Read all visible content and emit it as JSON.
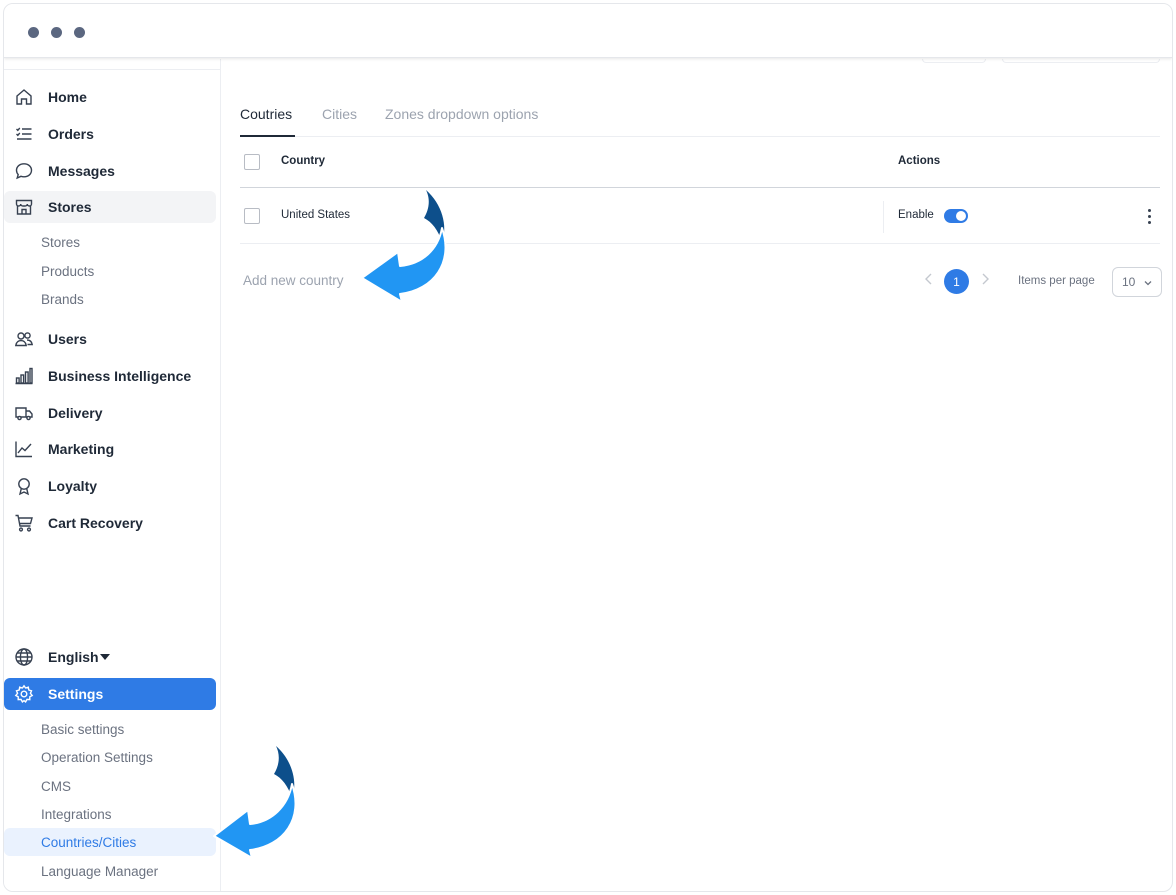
{
  "sidebar": {
    "home": "Home",
    "orders": "Orders",
    "messages": "Messages",
    "stores": "Stores",
    "stores_sub": [
      "Stores",
      "Products",
      "Brands"
    ],
    "users": "Users",
    "bi": "Business Intelligence",
    "delivery": "Delivery",
    "marketing": "Marketing",
    "loyalty": "Loyalty",
    "cart_recovery": "Cart Recovery",
    "language": "English",
    "settings": "Settings",
    "settings_sub": [
      "Basic settings",
      "Operation Settings",
      "CMS",
      "Integrations",
      "Countries/Cities",
      "Language Manager"
    ]
  },
  "tabs": [
    "Coutries",
    "Cities",
    "Zones dropdown options"
  ],
  "table": {
    "headers": {
      "country": "Country",
      "actions": "Actions"
    },
    "rows": [
      {
        "country": "United States",
        "status": "Enable"
      }
    ]
  },
  "add_link": "Add new country",
  "pagination": {
    "current_page": "1",
    "items_per_page_label": "Items per page",
    "items_per_page_value": "10"
  },
  "colors": {
    "accent": "#2f7be5",
    "arrow_light": "#2196f3",
    "arrow_dark": "#0d4f8b"
  }
}
